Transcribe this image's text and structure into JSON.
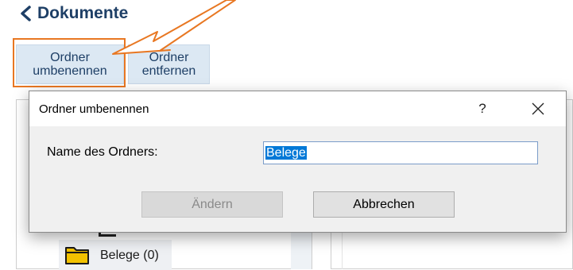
{
  "header": {
    "title": "Dokumente",
    "back_icon": "chevron-left-icon"
  },
  "toolbar": {
    "rename_line1": "Ordner",
    "rename_line2": "umbenennen",
    "remove_line1": "Ordner",
    "remove_line2": "entfernen"
  },
  "colors": {
    "brand_dark": "#1e3f66",
    "toolbar_bg": "#dce8f3",
    "highlight": "#e87722",
    "selection": "#0078d7",
    "folder": "#f2c200"
  },
  "tree": {
    "items": [
      {
        "label": "Belege (0)",
        "icon": "folder-icon"
      }
    ]
  },
  "dialog": {
    "title": "Ordner umbenennen",
    "help_label": "?",
    "close_icon": "close-icon",
    "field_label": "Name des Ordners:",
    "field_value": "Belege",
    "change_label": "Ändern",
    "cancel_label": "Abbrechen"
  }
}
